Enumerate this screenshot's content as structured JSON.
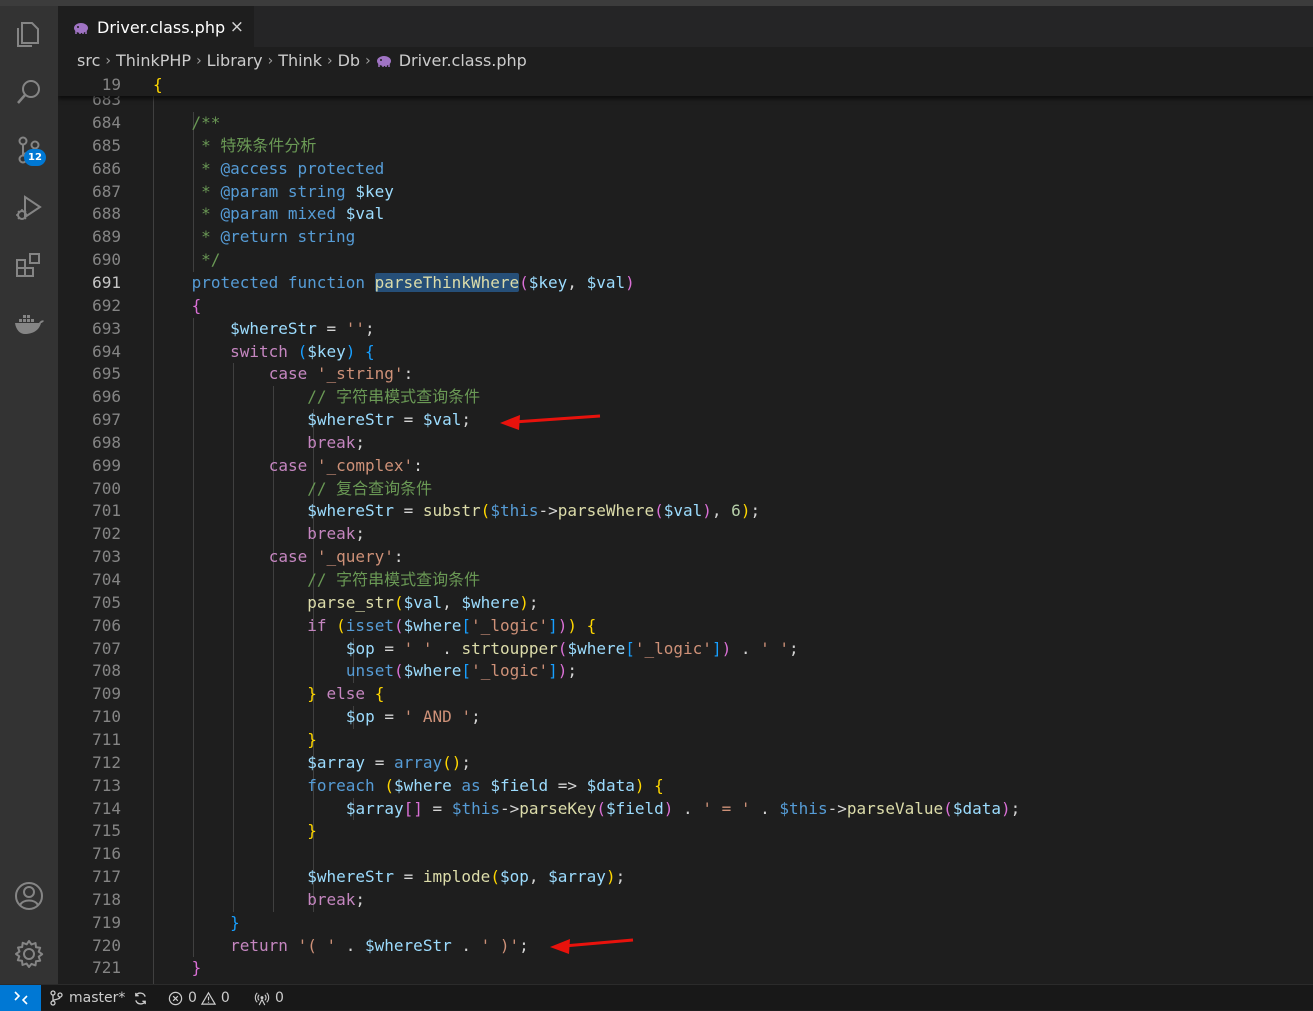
{
  "activity_bar": {
    "items": [
      "explorer-icon",
      "search-icon",
      "source-control-icon",
      "run-debug-icon",
      "extensions-icon",
      "docker-icon"
    ],
    "source_control_badge": "12",
    "bottom_items": [
      "accounts-icon",
      "manage-gear-icon"
    ]
  },
  "tab": {
    "label": "Driver.class.php",
    "close": "×"
  },
  "breadcrumb": [
    "src",
    "ThinkPHP",
    "Library",
    "Think",
    "Db",
    "Driver.class.php"
  ],
  "sticky_line": {
    "number": "19",
    "text": "{"
  },
  "partial_line_number": "683",
  "code_lines": [
    {
      "n": "684",
      "text": "    /**"
    },
    {
      "n": "685",
      "text": "     * 特殊条件分析"
    },
    {
      "n": "686",
      "text": "     * @access protected"
    },
    {
      "n": "687",
      "text": "     * @param string $key"
    },
    {
      "n": "688",
      "text": "     * @param mixed $val"
    },
    {
      "n": "689",
      "text": "     * @return string"
    },
    {
      "n": "690",
      "text": "     */"
    },
    {
      "n": "691",
      "text": "    protected function parseThinkWhere($key, $val)"
    },
    {
      "n": "692",
      "text": "    {"
    },
    {
      "n": "693",
      "text": "        $whereStr = '';"
    },
    {
      "n": "694",
      "text": "        switch ($key) {"
    },
    {
      "n": "695",
      "text": "            case '_string':"
    },
    {
      "n": "696",
      "text": "                // 字符串模式查询条件"
    },
    {
      "n": "697",
      "text": "                $whereStr = $val;"
    },
    {
      "n": "698",
      "text": "                break;"
    },
    {
      "n": "699",
      "text": "            case '_complex':"
    },
    {
      "n": "700",
      "text": "                // 复合查询条件"
    },
    {
      "n": "701",
      "text": "                $whereStr = substr($this->parseWhere($val), 6);"
    },
    {
      "n": "702",
      "text": "                break;"
    },
    {
      "n": "703",
      "text": "            case '_query':"
    },
    {
      "n": "704",
      "text": "                // 字符串模式查询条件"
    },
    {
      "n": "705",
      "text": "                parse_str($val, $where);"
    },
    {
      "n": "706",
      "text": "                if (isset($where['_logic'])) {"
    },
    {
      "n": "707",
      "text": "                    $op = ' ' . strtoupper($where['_logic']) . ' ';"
    },
    {
      "n": "708",
      "text": "                    unset($where['_logic']);"
    },
    {
      "n": "709",
      "text": "                } else {"
    },
    {
      "n": "710",
      "text": "                    $op = ' AND ';"
    },
    {
      "n": "711",
      "text": "                }"
    },
    {
      "n": "712",
      "text": "                $array = array();"
    },
    {
      "n": "713",
      "text": "                foreach ($where as $field => $data) {"
    },
    {
      "n": "714",
      "text": "                    $array[] = $this->parseKey($field) . ' = ' . $this->parseValue($data);"
    },
    {
      "n": "715",
      "text": "                }"
    },
    {
      "n": "716",
      "text": ""
    },
    {
      "n": "717",
      "text": "                $whereStr = implode($op, $array);"
    },
    {
      "n": "718",
      "text": "                break;"
    },
    {
      "n": "719",
      "text": "        }"
    },
    {
      "n": "720",
      "text": "        return '( ' . $whereStr . ' )';"
    },
    {
      "n": "721",
      "text": "    }"
    }
  ],
  "current_line": "691",
  "highlighted_word": "parseThinkWhere",
  "annotation_color": "#e8120c",
  "status_bar": {
    "branch": "master*",
    "errors": "0",
    "warnings": "0",
    "ports": "0"
  },
  "colors": {
    "keyword": "#569cd6",
    "variable": "#9cdcfe",
    "string": "#ce9178",
    "comment": "#6a9955",
    "function": "#dcdcaa",
    "bracket_gold": "#ffd700",
    "bracket_orchid": "#da70d6",
    "bracket_blue": "#179fff",
    "control_keyword": "#c586c0",
    "number": "#b5cea8",
    "accent": "#0078d4"
  }
}
